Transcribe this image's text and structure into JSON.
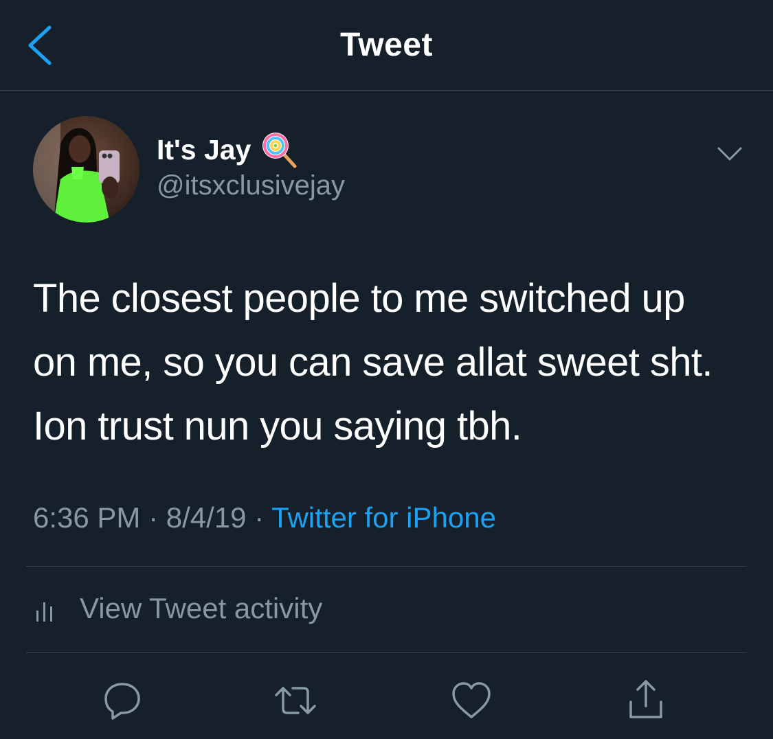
{
  "header": {
    "back_icon": "chevron-left-icon",
    "title": "Tweet"
  },
  "tweet": {
    "author": {
      "display_name": "It's Jay",
      "name_emoji": "lollipop-emoji",
      "handle": "@itsxclusivejay",
      "avatar": "avatar-photo"
    },
    "menu_icon": "chevron-down-icon",
    "text_lines": [
      "The closest people to me switched up",
      "on me, so you can save allat sweet sht.",
      "Ion trust nun you saying tbh."
    ],
    "time": "6:36 PM",
    "separator": "·",
    "date": "8/4/19",
    "source": "Twitter for iPhone"
  },
  "activity": {
    "icon": "bar-chart-icon",
    "label": "View Tweet activity"
  },
  "actions": [
    {
      "icon": "reply-icon"
    },
    {
      "icon": "retweet-icon"
    },
    {
      "icon": "like-icon"
    },
    {
      "icon": "share-icon"
    }
  ],
  "colors": {
    "background": "#15202b",
    "divider": "#38444d",
    "secondary_text": "#8899a6",
    "accent": "#1da1f2"
  }
}
